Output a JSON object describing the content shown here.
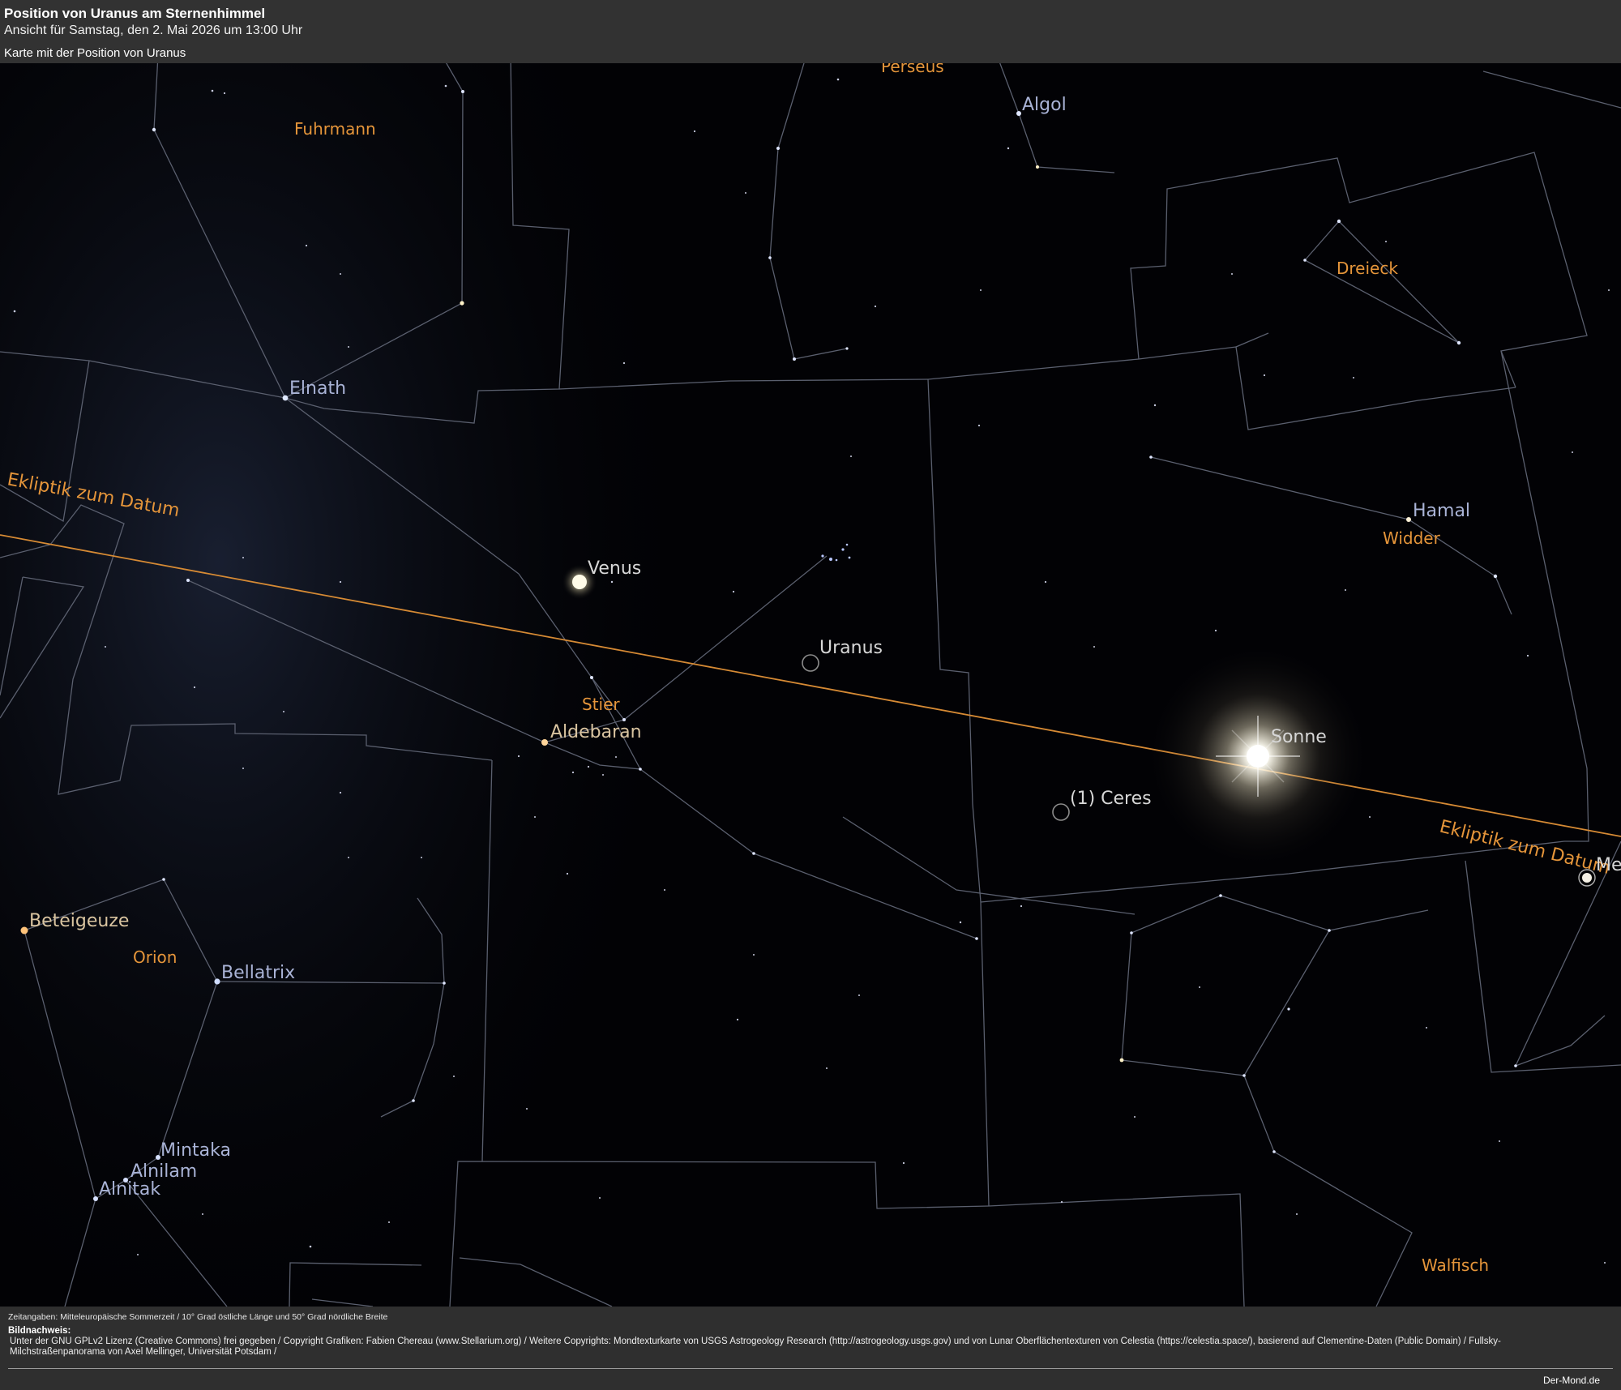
{
  "header": {
    "title": "Position von Uranus am Sternenhimmel",
    "subtitle": "Ansicht für Samstag, den 2. Mai 2026 um 13:00 Uhr",
    "caption": "Karte mit der Position von Uranus"
  },
  "map": {
    "ecliptic_label": "Ekliptik zum Datum",
    "ecliptic_label_right": "Ekliptik zum Datum",
    "constellations": {
      "perseus": "Perseus",
      "fuhrmann": "Fuhrmann",
      "dreieck": "Dreieck",
      "widder": "Widder",
      "stier": "Stier",
      "orion": "Orion",
      "walfisch": "Walfisch"
    },
    "stars": {
      "algol": "Algol",
      "elnath": "Elnath",
      "hamal": "Hamal",
      "aldebaran": "Aldebaran",
      "beteigeuze": "Beteigeuze",
      "bellatrix": "Bellatrix",
      "mintaka": "Mintaka",
      "alnilam": "Alnilam",
      "alnitak": "Alnitak"
    },
    "bodies": {
      "venus": "Venus",
      "uranus": "Uranus",
      "sonne": "Sonne",
      "ceres": "(1) Ceres",
      "merkur_partial": "Me"
    },
    "colors": {
      "constellation_lines": "#5a5f6e",
      "ecliptic": "#d68a34",
      "constellation_labels": "#e5953a",
      "star_labels": "#a9b3d6"
    }
  },
  "footer": {
    "time_info": "Zeitangaben: Mitteleuropäische Sommerzeit / 10° Grad östliche Länge und 50° Grad nördliche Breite",
    "credits_heading": "Bildnachweis:",
    "credits_text": "Unter der GNU GPLv2 Lizenz (Creative Commons) frei gegeben / Copyright Grafiken: Fabien Chereau (www.Stellarium.org) / Weitere Copyrights: Mondtexturkarte von USGS Astrogeology Research (http://astrogeology.usgs.gov) und von Lunar Oberflächentexturen von Celestia (https://celestia.space/), basierend auf Clementine-Daten (Public Domain) / Fullsky-Milchstraßenpanorama von Axel Mellinger, Universität Potsdam /",
    "brand": "Der-Mond.de"
  }
}
